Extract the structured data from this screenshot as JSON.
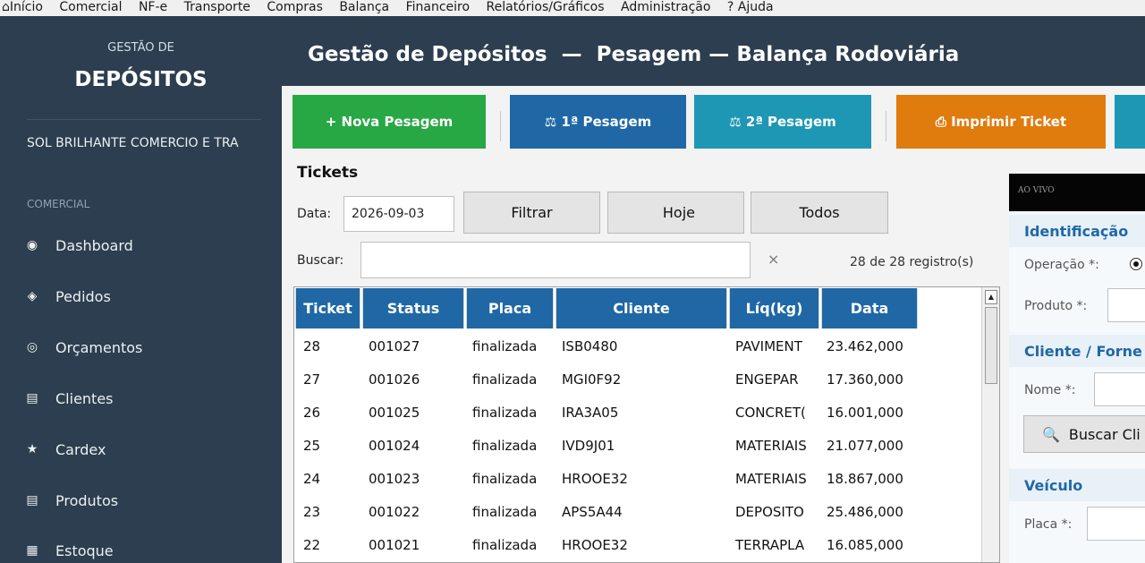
{
  "menubar": {
    "home_icon": "home-icon",
    "items": [
      "Início",
      "Comercial",
      "NF-e",
      "Transporte",
      "Compras",
      "Balança",
      "Financeiro",
      "Relatórios/Gráficos",
      "Administração",
      "? Ajuda"
    ]
  },
  "sidebar": {
    "brand_small": "GESTÃO DE",
    "brand_big": "DEPÓSITOS",
    "company": "SOL BRILHANTE COMERCIO E TRA",
    "section": "COMERCIAL",
    "items": [
      {
        "icon": "◉",
        "icon_name": "radio-icon",
        "label": "Dashboard"
      },
      {
        "icon": "◈",
        "icon_name": "diamond-icon",
        "label": "Pedidos"
      },
      {
        "icon": "◎",
        "icon_name": "circle-icon",
        "label": "Orçamentos"
      },
      {
        "icon": "▤",
        "icon_name": "list-icon",
        "label": "Clientes"
      },
      {
        "icon": "★",
        "icon_name": "star-icon",
        "label": "Cardex"
      },
      {
        "icon": "▤",
        "icon_name": "list-icon",
        "label": "Produtos"
      },
      {
        "icon": "▦",
        "icon_name": "grid-icon",
        "label": "Estoque"
      }
    ]
  },
  "header": {
    "title": "Gestão de Depósitos  —  Pesagem — Balança Rodoviária"
  },
  "toolbar": {
    "buttons": [
      {
        "label": "+ Nova Pesagem",
        "color": "#28a745"
      },
      {
        "label": "⚖ 1ª Pesagem",
        "color": "#1f68a5"
      },
      {
        "label": "⚖ 2ª Pesagem",
        "color": "#1e97b5"
      },
      {
        "label": "⎙ Imprimir Ticket",
        "color": "#e07b0e"
      },
      {
        "label": "",
        "color": "#1e97b5"
      }
    ]
  },
  "tickets": {
    "title": "Tickets",
    "date_label": "Data:",
    "date_value": "2026-09-03",
    "filter_button": "Filtrar",
    "today_button": "Hoje",
    "all_button": "Todos",
    "search_label": "Buscar:",
    "search_value": "",
    "clear_icon": "×",
    "count": "28 de 28 registro(s)",
    "columns": [
      "Ticket",
      "Status",
      "Placa",
      "Cliente",
      "Líq(kg)",
      "Data"
    ],
    "rows": [
      [
        "28",
        "001027",
        "finalizada",
        "ISB0480",
        "PAVIMENT",
        "23.462,000"
      ],
      [
        "27",
        "001026",
        "finalizada",
        "MGI0F92",
        "ENGEPAR",
        "17.360,000"
      ],
      [
        "26",
        "001025",
        "finalizada",
        "IRA3A05",
        "CONCRET(",
        "16.001,000"
      ],
      [
        "25",
        "001024",
        "finalizada",
        "IVD9J01",
        "MATERIAIS",
        "21.077,000"
      ],
      [
        "24",
        "001023",
        "finalizada",
        "HROOE32",
        "MATERIAIS",
        "18.867,000"
      ],
      [
        "23",
        "001022",
        "finalizada",
        "APS5A44",
        "DEPOSITO",
        "25.486,000"
      ],
      [
        "22",
        "001021",
        "finalizada",
        "HROOE32",
        "TERRAPLA",
        "16.085,000"
      ]
    ]
  },
  "right_panel": {
    "video_label": "AO VIVO",
    "identification": "Identificação",
    "operation_label": "Operação *:",
    "product_label": "Produto *:",
    "client_section": "Cliente / Forne",
    "name_label": "Nome *:",
    "search_client_button": "Buscar Cli",
    "search_client_icon": "magnifier-icon",
    "vehicle_section": "Veículo",
    "plate_label": "Placa *:"
  },
  "colors": {
    "sidebar_bg": "#2c3e50",
    "table_header": "#1f68a5"
  }
}
